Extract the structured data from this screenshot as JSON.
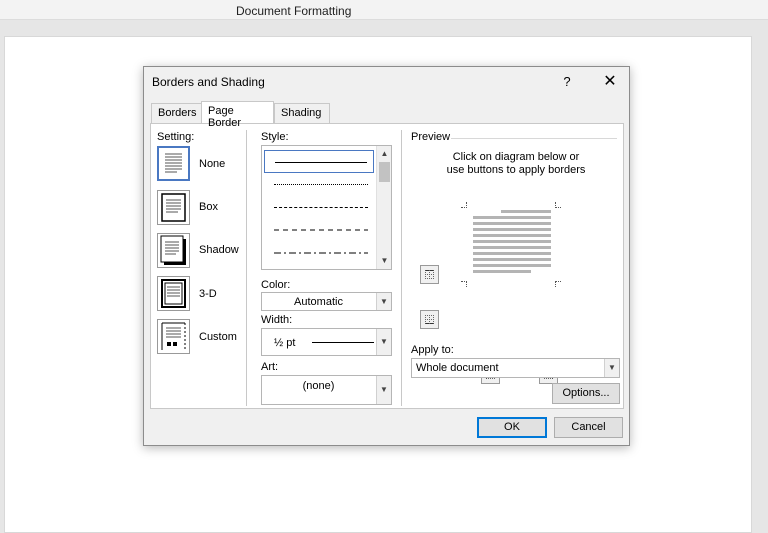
{
  "app": {
    "window_title": "Document Formatting"
  },
  "dialog": {
    "title": "Borders and Shading",
    "help_label": "?",
    "close_label": "✕",
    "tabs": [
      {
        "label": "Borders",
        "active": false
      },
      {
        "label": "Page Border",
        "active": true
      },
      {
        "label": "Shading",
        "active": false
      }
    ],
    "setting": {
      "header": "Setting:",
      "items": [
        {
          "label": "None",
          "selected": true
        },
        {
          "label": "Box",
          "selected": false
        },
        {
          "label": "Shadow",
          "selected": false
        },
        {
          "label": "3-D",
          "selected": false
        },
        {
          "label": "Custom",
          "selected": false
        }
      ]
    },
    "style": {
      "header": "Style:",
      "items": [
        "solid",
        "dotted",
        "dashed-small",
        "dashed",
        "dash-dot"
      ],
      "selected_index": 0
    },
    "color": {
      "header": "Color:",
      "value": "Automatic"
    },
    "width": {
      "header": "Width:",
      "value": "½ pt"
    },
    "art": {
      "header": "Art:",
      "value": "(none)"
    },
    "preview": {
      "header": "Preview",
      "instruction_line1": "Click on diagram below or",
      "instruction_line2": "use buttons to apply borders"
    },
    "apply_to": {
      "header": "Apply to:",
      "value": "Whole document"
    },
    "options_label": "Options...",
    "ok_label": "OK",
    "cancel_label": "Cancel"
  },
  "colors": {
    "accent": "#0078d7",
    "selection": "#4a78c2"
  }
}
